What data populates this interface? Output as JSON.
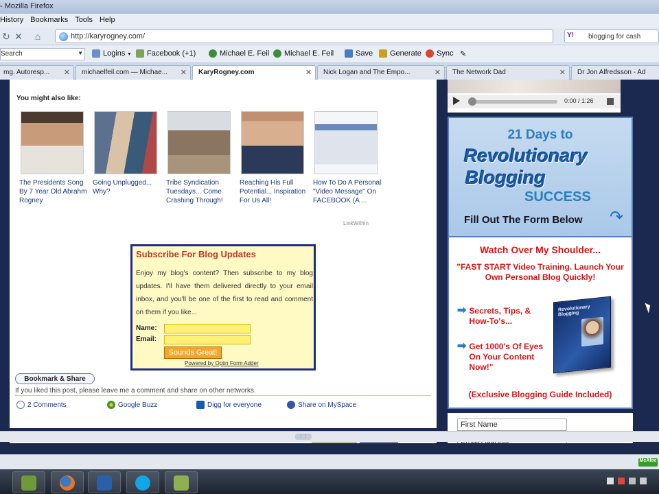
{
  "window": {
    "title": "- Mozilla Firefox"
  },
  "menu": [
    "History",
    "Bookmarks",
    "Tools",
    "Help"
  ],
  "nav": {
    "url": "http://karyrogney.com/",
    "search_engine": "Y!",
    "search_query": "blogging for cash"
  },
  "bookmarks": {
    "search_label": "Search",
    "items": [
      "Logins",
      "Facebook (+1)",
      "Michael E. Feil",
      "Michael E. Feil",
      "Save",
      "Generate",
      "Sync"
    ]
  },
  "tabs": [
    {
      "label": "mg. Autoresp...",
      "active": false
    },
    {
      "label": "michaelfeil.com — Michae...",
      "active": false
    },
    {
      "label": "KaryRogney.com",
      "active": true
    },
    {
      "label": "Nick Logan and The Empo...",
      "active": false
    },
    {
      "label": "The Network Dad",
      "active": false
    },
    {
      "label": "Dr Jon Alfredsson - Ad",
      "active": false
    }
  ],
  "related": {
    "title": "You might also like:",
    "items": [
      {
        "caption": "The Presidents Song By 7 Year Old Abrahm Rogney"
      },
      {
        "caption": "Going Unplugged... Why?"
      },
      {
        "caption": "Tribe Syndication Tuesdays... Come Crashing Through!"
      },
      {
        "caption": "Reaching His Full Potential... Inspiration For Us All!"
      },
      {
        "caption": "How To Do A Personal \"Video Message\" On FACEBOOK (A ..."
      }
    ],
    "credit": "LinkWithin"
  },
  "subscribe": {
    "title": "Subscribe For Blog Updates",
    "text": "Enjoy my blog's content? Then subscribe to my blog updates. I'll have them delivered directly to your email inbox, and you'll be one of the first to read and comment on them if you like...",
    "name_label": "Name:",
    "email_label": "Email:",
    "button": "Sounds Great!",
    "powered": "Powered by Optin Form Adder"
  },
  "share": {
    "button": "Bookmark & Share",
    "note": "If you liked this post, please leave me a comment and share on other networks.",
    "links": [
      "2 Comments",
      "Google Buzz",
      "Digg for everyone",
      "Share on MySpace"
    ]
  },
  "video": {
    "time": "0:00 / 1:26"
  },
  "ad": {
    "days": "21 Days to",
    "big1": "Revolutionary",
    "big2": "Blogging",
    "success": "SUCCESS",
    "fill": "Fill Out The Form Below",
    "watch": "Watch Over My Shoulder...",
    "fast": "\"FAST START Video Training. Launch Your Own Personal Blog Quickly!",
    "bullets": [
      "Secrets, Tips, & How-To's...",
      "Get 1000's Of Eyes On Your Content Now!\""
    ],
    "ebook_title": "Revolutionary Blogging",
    "exclusive": "(Exclusive Blogging Guide Included)"
  },
  "form": {
    "first_name": "First Name",
    "email": "Email Address"
  },
  "status": {
    "badge": "McAfee"
  },
  "colors": {
    "accent": "#1e2a8c",
    "ad_red": "#dd1111",
    "ad_blue": "#1a5ba8"
  }
}
